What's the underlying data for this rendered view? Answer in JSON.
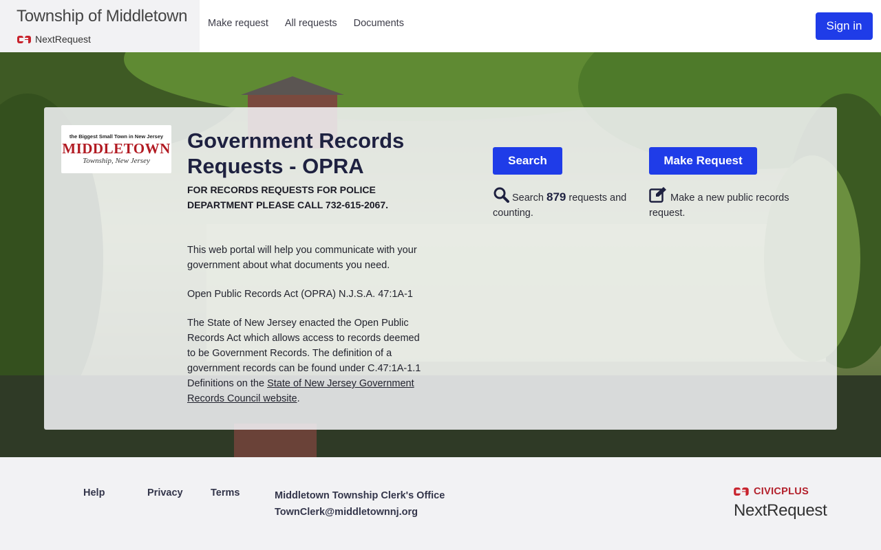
{
  "header": {
    "site_title": "Township of Middletown",
    "brand": "NextRequest",
    "nav": [
      "Make request",
      "All requests",
      "Documents"
    ],
    "sign_in": "Sign in"
  },
  "panel": {
    "logo": {
      "tagline": "the Biggest Small Town in New Jersey",
      "name": "MIDDLETOWN",
      "sub": "Township, New Jersey"
    },
    "title": "Government Records Requests - OPRA",
    "notice": "FOR RECORDS REQUESTS FOR POLICE DEPARTMENT PLEASE CALL 732-615-2067.",
    "intro_1": "This web portal will help you communicate with your government about what documents you need.",
    "intro_2": "Open Public Records Act (OPRA) N.J.S.A. 47:1A-1",
    "intro_3": "The State of New Jersey enacted the Open Public Records Act which allows access to records deemed to be Government Records. The definition of a government records can be found under C.47:1A-1.1 Definitions on the ",
    "intro_link": "State of New Jersey Government Records Council website",
    "intro_end": ".",
    "search": {
      "button": "Search",
      "pre": "Search",
      "count": "879",
      "post": "requests and counting."
    },
    "make": {
      "button": "Make Request",
      "text": "Make a new public records request."
    }
  },
  "footer": {
    "links": [
      "Help",
      "Privacy",
      "Terms"
    ],
    "office": "Middletown Township Clerk's Office",
    "email": "TownClerk@middletownnj.org",
    "civic": "CIVICPLUS",
    "product": "NextRequest"
  },
  "colors": {
    "primary": "#1f3ce8",
    "heading": "#1e2140",
    "brand_red": "#b3202b"
  }
}
